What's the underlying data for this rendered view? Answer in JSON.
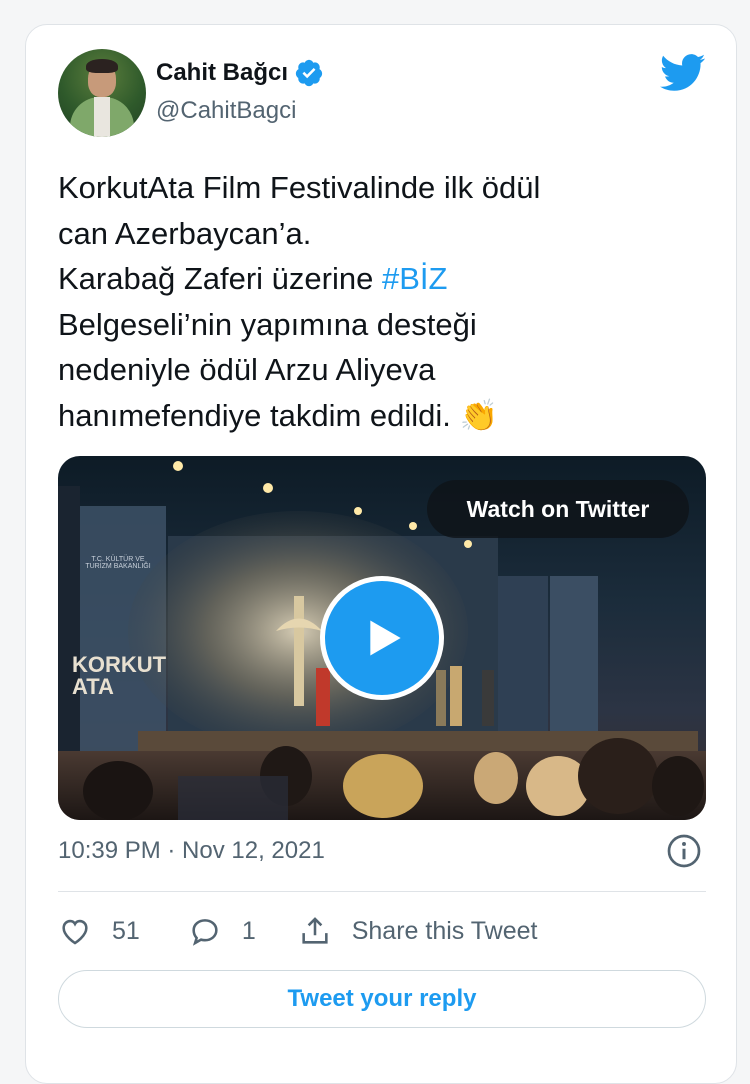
{
  "author": {
    "name": "Cahit Bağcı",
    "handle": "@CahitBagci",
    "verified": true
  },
  "tweet": {
    "lines": [
      "KorkutAta Film Festivalinde ilk ödül",
      "can Azerbaycan’a.",
      "Karabağ Zaferi üzerine ",
      "Belgeseli’nin yapımına desteği",
      "nedeniyle ödül Arzu Aliyeva",
      "hanımefendiye takdim edildi. 👏"
    ],
    "hashtag": "#BİZ"
  },
  "media": {
    "watch_label": "Watch on Twitter",
    "stage_text_1": "KORKUT",
    "stage_text_2": "ATA",
    "stage_subtext": "T.C. KÜLTÜR VE TURİZM BAKANLIĞI"
  },
  "meta": {
    "timestamp": "10:39 PM · Nov 12, 2021"
  },
  "actions": {
    "likes": "51",
    "replies": "1",
    "share_label": "Share this Tweet"
  },
  "reply": {
    "label": "Tweet your reply"
  },
  "colors": {
    "accent": "#1d9bf0",
    "text": "#0f1419",
    "muted": "#536471"
  }
}
